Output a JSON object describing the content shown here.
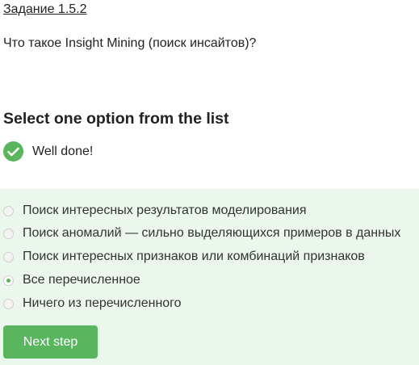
{
  "header": {
    "step_link": "Задание 1.5.2"
  },
  "question": {
    "text": "Что такое Insight Mining (поиск инсайтов)?"
  },
  "quiz": {
    "title": "Select one option from the list",
    "feedback": {
      "text": "Well done!",
      "icon": "check-circle-icon",
      "color": "#59b65f"
    },
    "options": [
      {
        "label": "Поиск интересных результатов моделирования",
        "selected": false
      },
      {
        "label": "Поиск аномалий — сильно выделяющихся примеров в данных",
        "selected": false
      },
      {
        "label": "Поиск интересных признаков или комбинаций признаков",
        "selected": false
      },
      {
        "label": "Все перечисленное",
        "selected": true
      },
      {
        "label": "Ничего из перечисленного",
        "selected": false
      }
    ]
  },
  "actions": {
    "next_label": "Next step"
  },
  "colors": {
    "accent": "#59b65f",
    "options_background": "#ebf7ec"
  }
}
